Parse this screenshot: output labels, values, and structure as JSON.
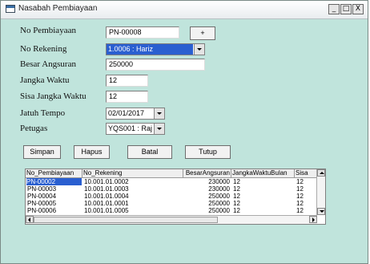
{
  "window": {
    "title": "Nasabah Pembiayaan",
    "minimize": "_",
    "maximize": "□",
    "close": "X"
  },
  "colors": {
    "form_bg": "#c0e4dc",
    "selection": "#2a5fd0"
  },
  "form": {
    "no_pembiayaan": {
      "label": "No Pembiayaan",
      "value": "PN-00008",
      "add_button": "+"
    },
    "no_rekening": {
      "label": "No Rekening",
      "value": "1.0006 : Hariz"
    },
    "besar_angsuran": {
      "label": "Besar Angsuran",
      "value": "250000"
    },
    "jangka_waktu": {
      "label": "Jangka Waktu",
      "value": "12"
    },
    "sisa_jangka_waktu": {
      "label": "Sisa Jangka Waktu",
      "value": "12"
    },
    "jatuh_tempo": {
      "label": "Jatuh Tempo",
      "value": "02/01/2017"
    },
    "petugas": {
      "label": "Petugas",
      "value": "YQS001 : Raj"
    }
  },
  "buttons": {
    "simpan": "Simpan",
    "hapus": "Hapus",
    "batal": "Batal",
    "tutup": "Tutup"
  },
  "grid": {
    "columns": [
      "No_Pembiayaan",
      "No_Rekening",
      "BesarAngsuran",
      "JangkaWaktuBulan",
      "Sisa"
    ],
    "rows": [
      [
        "PN-00002",
        "10.001.01.0002",
        "230000",
        "12",
        "12"
      ],
      [
        "PN-00003",
        "10.001.01.0003",
        "230000",
        "12",
        "12"
      ],
      [
        "PN-00004",
        "10.001.01.0004",
        "250000",
        "12",
        "12"
      ],
      [
        "PN-00005",
        "10.001.01.0001",
        "250000",
        "12",
        "12"
      ],
      [
        "PN-00006",
        "10.001.01.0005",
        "250000",
        "12",
        "12"
      ]
    ]
  }
}
